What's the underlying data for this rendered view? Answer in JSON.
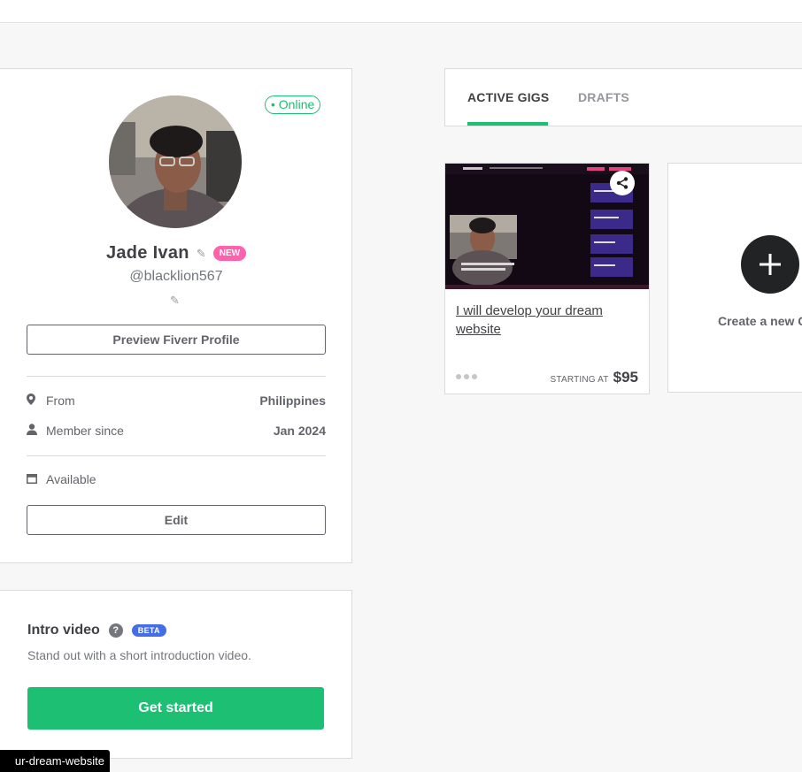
{
  "profile": {
    "status": "• Online",
    "name": "Jade Ivan",
    "badge": "NEW",
    "username": "@blacklion567",
    "preview_button": "Preview Fiverr Profile",
    "from_label": "From",
    "from_value": "Philippines",
    "member_label": "Member since",
    "member_value": "Jan 2024",
    "availability": "Available",
    "edit_button": "Edit"
  },
  "intro_video": {
    "title": "Intro video",
    "badge": "BETA",
    "subtitle": "Stand out with a short introduction video.",
    "button": "Get started"
  },
  "tabs": {
    "active": "ACTIVE GIGS",
    "drafts": "DRAFTS"
  },
  "gig": {
    "title": "I will develop your dream website",
    "starting_label": "STARTING AT",
    "price": "$95"
  },
  "create": {
    "label": "Create a new Gig"
  },
  "status_bar": {
    "url": "ur-dream-website"
  },
  "colors": {
    "accent_green": "#1dbf73",
    "new_badge": "#ff62ad",
    "beta_badge": "#446ee7"
  },
  "icons": [
    "pencil-icon",
    "location-pin-icon",
    "user-icon",
    "calendar-icon",
    "question-icon",
    "share-icon",
    "plus-icon"
  ]
}
